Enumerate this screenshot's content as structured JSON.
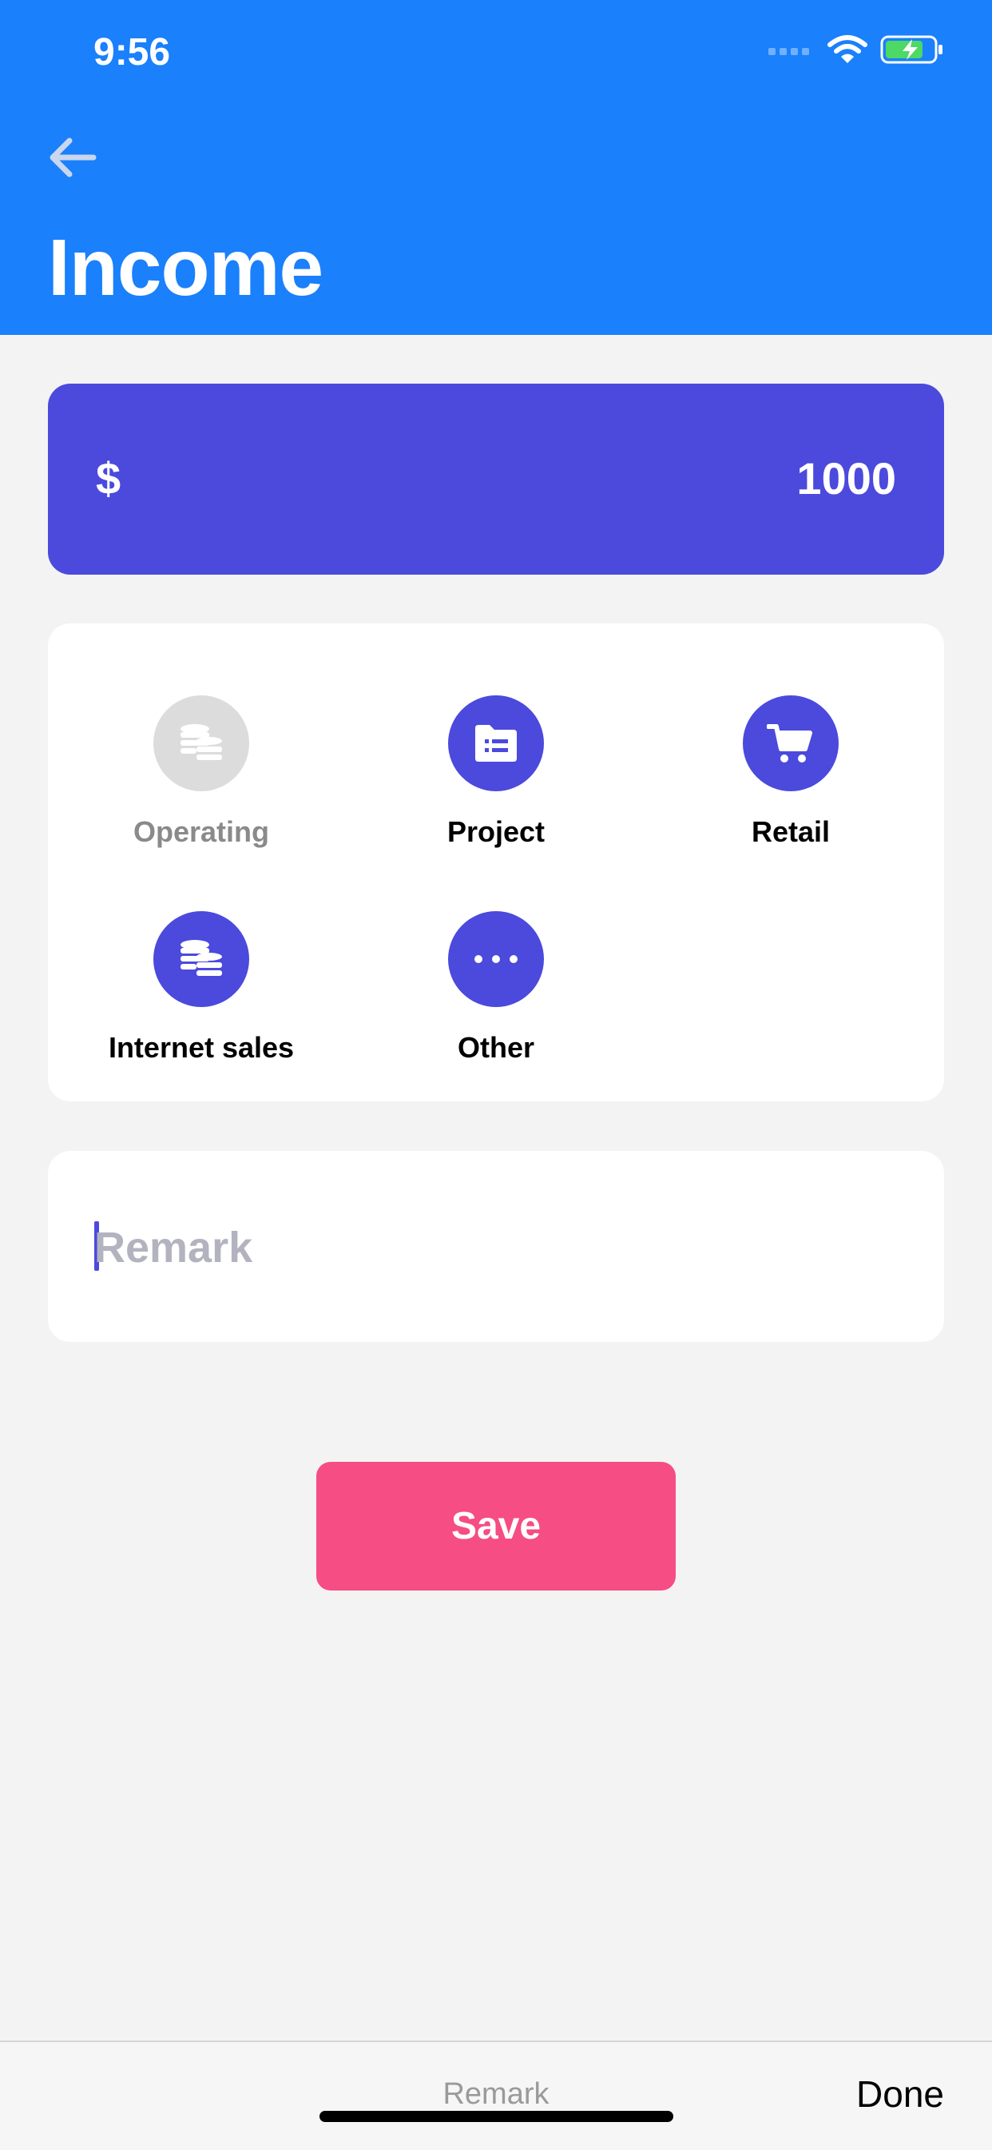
{
  "status_bar": {
    "time": "9:56"
  },
  "header": {
    "title": "Income"
  },
  "amount": {
    "currency": "$",
    "value": "1000"
  },
  "categories": [
    {
      "label": "Operating",
      "icon": "coins-icon",
      "selected": false
    },
    {
      "label": "Project",
      "icon": "folder-list-icon",
      "selected": true
    },
    {
      "label": "Retail",
      "icon": "cart-icon",
      "selected": true
    },
    {
      "label": "Internet sales",
      "icon": "coins-icon",
      "selected": true
    },
    {
      "label": "Other",
      "icon": "more-dots-icon",
      "selected": true
    }
  ],
  "remark": {
    "placeholder": "Remark",
    "value": ""
  },
  "save_label": "Save",
  "keyboard_toolbar": {
    "label": "Remark",
    "done_label": "Done"
  },
  "colors": {
    "header": "#1a80fb",
    "accent": "#4b4add",
    "save": "#f54d84",
    "inactive": "#dcdcdc"
  }
}
